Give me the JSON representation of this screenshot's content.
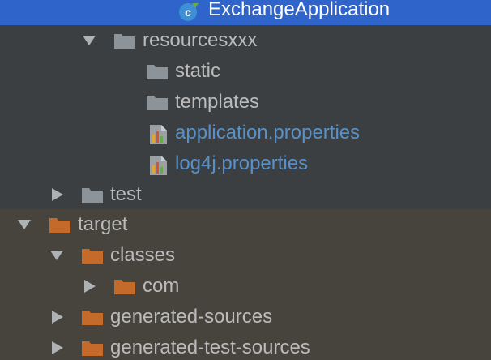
{
  "colors": {
    "panel_bg": "#3c3f41",
    "excluded_bg": "#46443c",
    "selection_bg": "#2f65ca",
    "text": "#bbbbbb",
    "properties_text": "#5891c9",
    "folder_gray": "#8d9499",
    "folder_orange": "#c46a2a"
  },
  "tree": {
    "items": [
      {
        "label": "ExchangeApplication",
        "icon": "java-class-icon",
        "selected": true
      },
      {
        "label": "resourcesxxx",
        "icon": "folder-icon",
        "expanded": true
      },
      {
        "label": "static",
        "icon": "folder-icon"
      },
      {
        "label": "templates",
        "icon": "folder-icon"
      },
      {
        "label": "application.properties",
        "icon": "properties-file-icon"
      },
      {
        "label": "log4j.properties",
        "icon": "properties-file-icon"
      },
      {
        "label": "test",
        "icon": "folder-icon",
        "expanded": false
      },
      {
        "label": "target",
        "icon": "excluded-folder-icon",
        "expanded": true,
        "excluded": true
      },
      {
        "label": "classes",
        "icon": "excluded-folder-icon",
        "expanded": true,
        "excluded": true
      },
      {
        "label": "com",
        "icon": "excluded-folder-icon",
        "expanded": false,
        "excluded": true
      },
      {
        "label": "generated-sources",
        "icon": "excluded-folder-icon",
        "expanded": false,
        "excluded": true
      },
      {
        "label": "generated-test-sources",
        "icon": "excluded-folder-icon",
        "expanded": false,
        "excluded": true
      }
    ]
  }
}
